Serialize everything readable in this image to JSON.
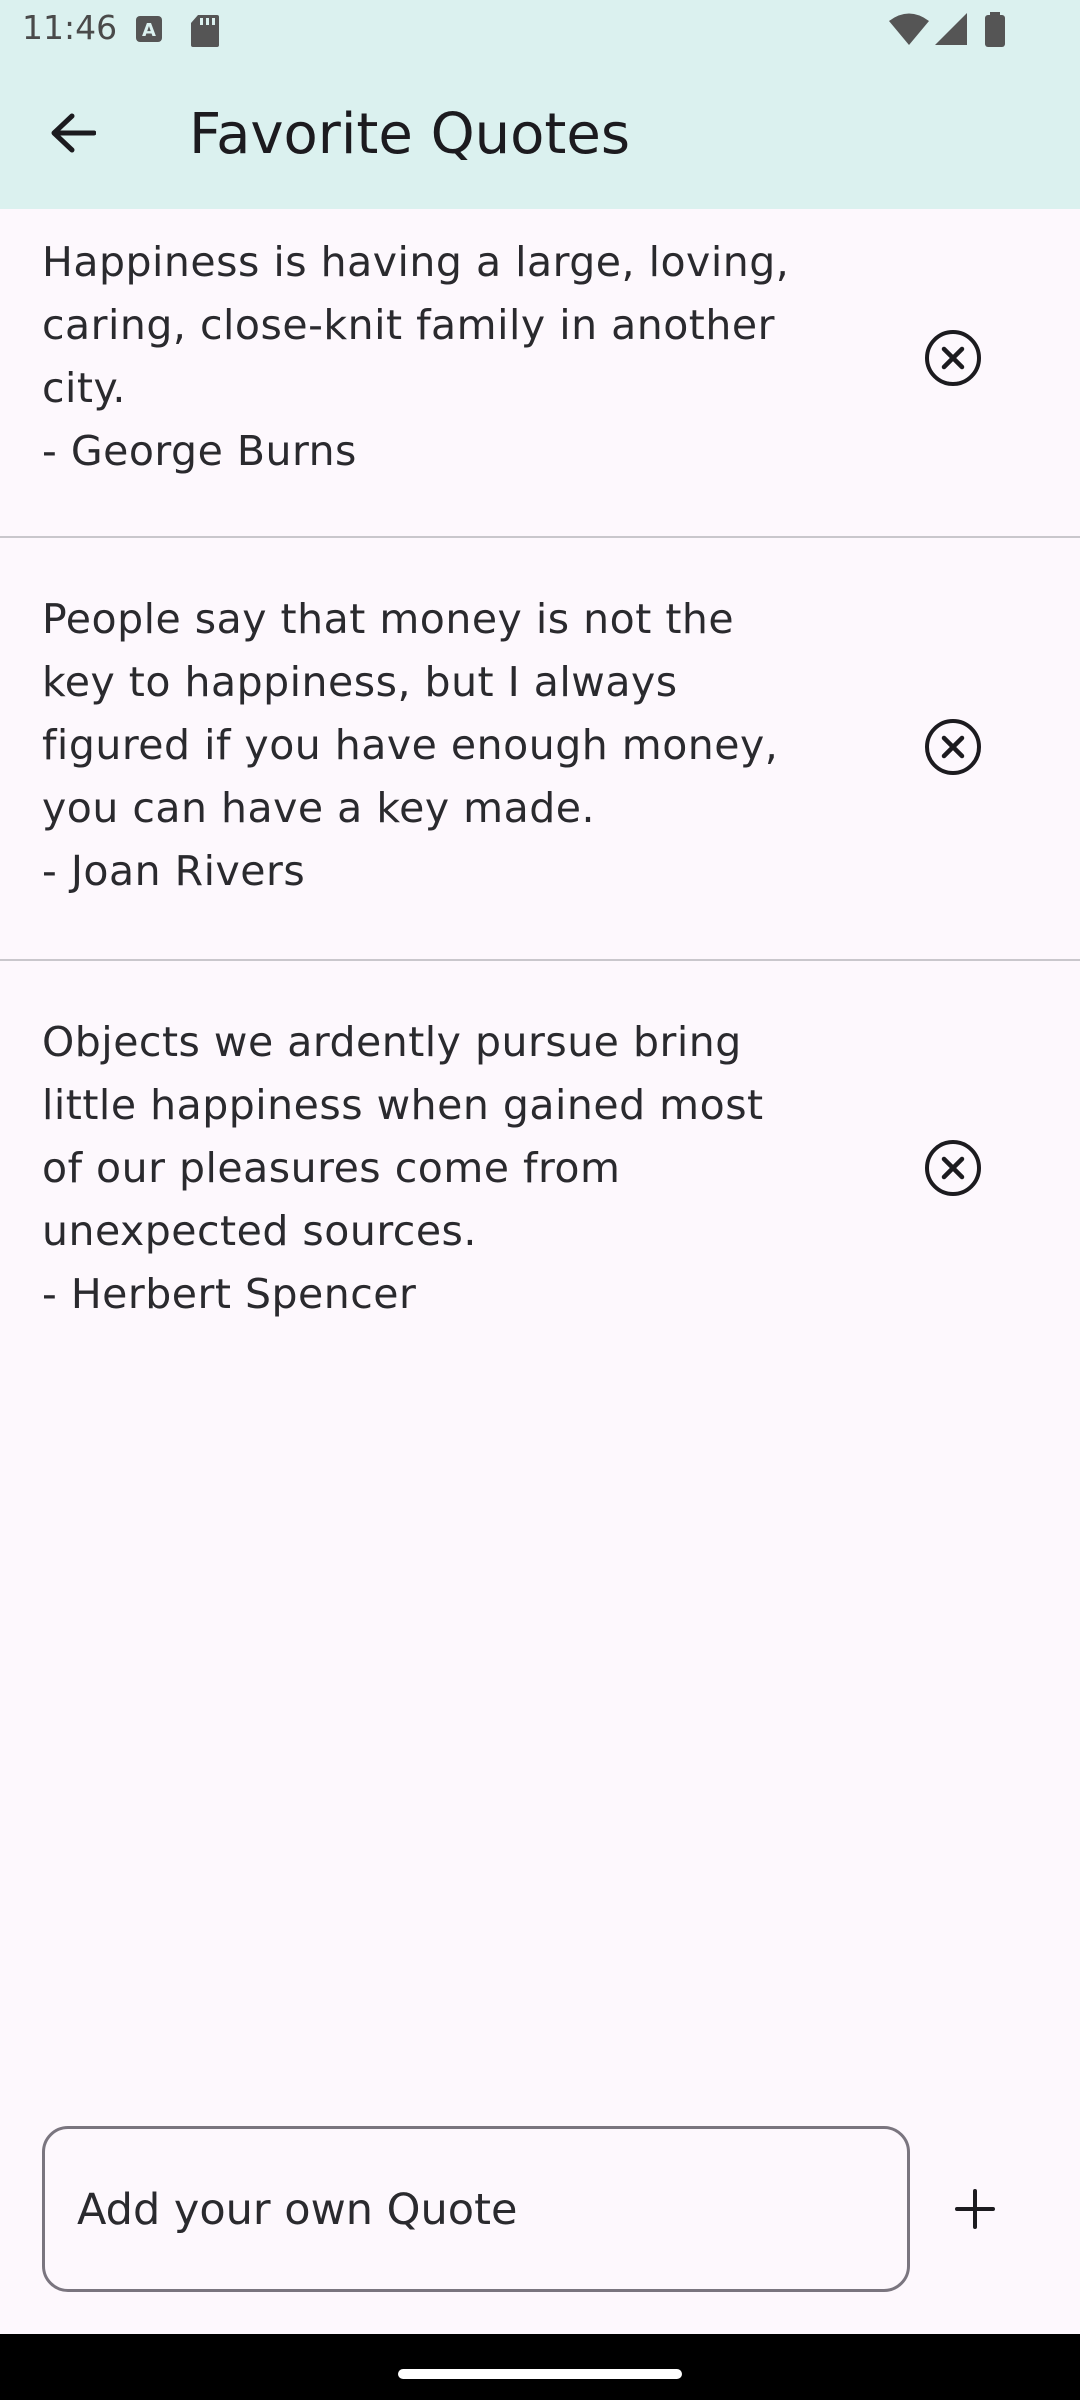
{
  "status_bar": {
    "time": "11:46"
  },
  "app_bar": {
    "title": "Favorite Quotes"
  },
  "quotes": [
    {
      "text": "Happiness is having a large, loving,\ncaring, close-knit family in another\ncity.\n- George Burns"
    },
    {
      "text": "People say that money is not the\nkey to happiness, but I always\nfigured if you have enough money,\nyou can have a key made.\n- Joan Rivers"
    },
    {
      "text": "Objects we ardently pursue bring\nlittle happiness when gained most\nof our pleasures come from\nunexpected sources.\n- Herbert Spencer"
    }
  ],
  "composer": {
    "placeholder": "Add your own Quote",
    "value": ""
  },
  "colors": {
    "app_bar_bg": "#dbf1ef",
    "page_bg": "#fdf8fd",
    "divider": "#c9c7cc"
  },
  "icons": [
    "back-arrow-icon",
    "remove-circle-icon",
    "add-icon"
  ]
}
